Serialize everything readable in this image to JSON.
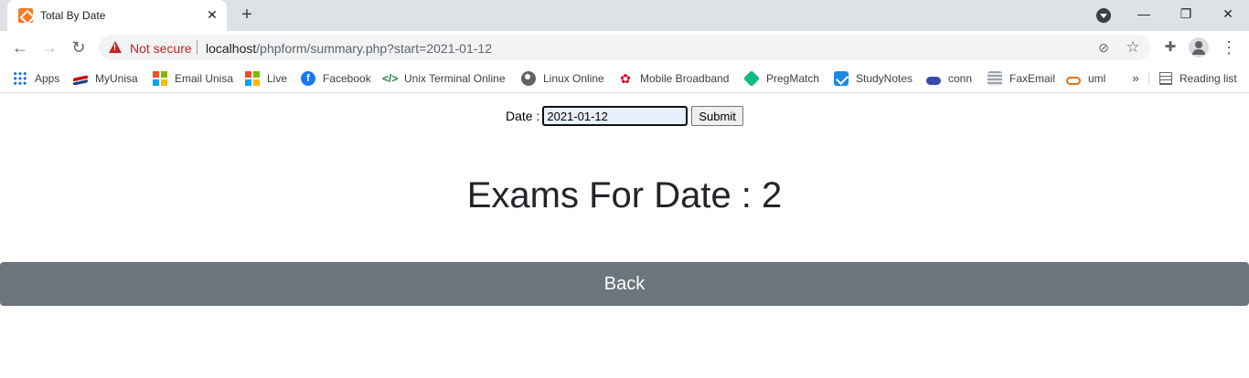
{
  "browser": {
    "tab": {
      "title": "Total By Date",
      "close_glyph": "✕",
      "favicon": "xampp-icon"
    },
    "new_tab_glyph": "+",
    "window_controls": {
      "minimize": "—",
      "restore": "❐",
      "close": "✕"
    },
    "toolbar": {
      "back_glyph": "←",
      "forward_glyph": "→",
      "reload_glyph": "↻",
      "security_label": "Not secure",
      "url_host": "localhost",
      "url_path": "/phpform/summary.php?start=2021-01-12",
      "eye_glyph": "⊘",
      "star_glyph": "☆",
      "extensions_glyph": "✚",
      "menu_glyph": "⋮"
    },
    "bookmarks": [
      {
        "label": "Apps",
        "icon": "apps-grid-icon"
      },
      {
        "label": "MyUnisa",
        "icon": "unisa-icon"
      },
      {
        "label": "Email Unisa",
        "icon": "microsoft-icon"
      },
      {
        "label": "Live",
        "icon": "microsoft-icon"
      },
      {
        "label": "Facebook",
        "icon": "facebook-icon",
        "glyph": "f"
      },
      {
        "label": "Unix Terminal Online",
        "icon": "code-icon",
        "glyph": "</>"
      },
      {
        "label": "Linux Online",
        "icon": "globe-icon"
      },
      {
        "label": "Mobile Broadband",
        "icon": "huawei-icon",
        "glyph": "✿"
      },
      {
        "label": "PregMatch",
        "icon": "pregmatch-icon"
      },
      {
        "label": "StudyNotes",
        "icon": "studynotes-icon"
      },
      {
        "label": "conn",
        "icon": "cloud-icon"
      },
      {
        "label": "FaxEmail",
        "icon": "fax-icon"
      },
      {
        "label": "uml",
        "icon": "cloud-outline-icon"
      }
    ],
    "bookmarks_more_glyph": "»",
    "reading_list": {
      "label": "Reading list",
      "icon": "reading-list-icon"
    }
  },
  "page": {
    "form": {
      "date_label": "Date :",
      "date_value": "2021-01-12",
      "submit_label": "Submit"
    },
    "heading": "Exams For Date : 2",
    "back_label": "Back"
  },
  "colors": {
    "back_button": "#6c757d",
    "warning": "#c5221f",
    "tabstrip": "#dee1e6"
  }
}
